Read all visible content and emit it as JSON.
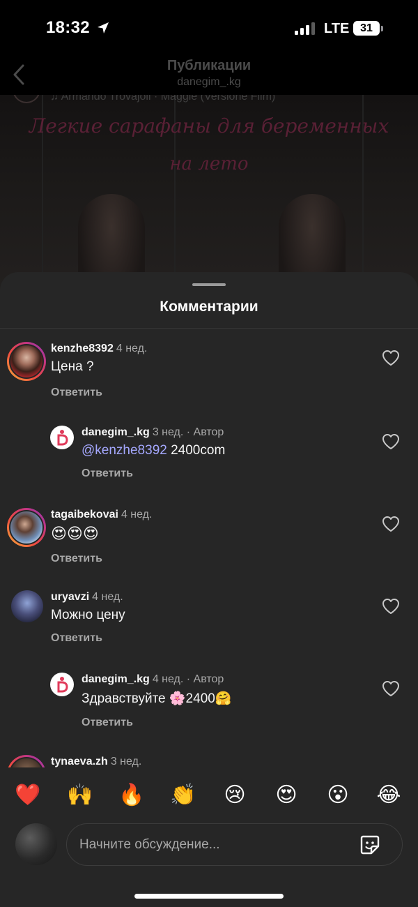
{
  "status_bar": {
    "time": "18:32",
    "network": "LTE",
    "battery": "31"
  },
  "header": {
    "title": "Публикации",
    "subtitle": "danegim_.kg"
  },
  "post": {
    "music": "Armando Trovajoli · Maggie (Versione Film)",
    "caption_line1": "Легкие сарафаны для беременных",
    "caption_line2": "на лето"
  },
  "sheet": {
    "title": "Комментарии"
  },
  "comments": [
    {
      "user": "kenzhe8392",
      "time": "4 нед.",
      "text": "Цена ?",
      "reply": "Ответить"
    },
    {
      "user": "danegim_.kg",
      "time": "3 нед. · Автор",
      "mention": "@kenzhe8392",
      "text": "2400com",
      "reply": "Ответить"
    },
    {
      "user": "tagaibekovai",
      "time": "4 нед.",
      "text": "😍😍😍",
      "reply": "Ответить"
    },
    {
      "user": "uryavzi",
      "time": "4 нед.",
      "text": "Можно цену",
      "reply": "Ответить"
    },
    {
      "user": "danegim_.kg",
      "time": "4 нед. · Автор",
      "text": "Здравствуйте 🌸2400🤗",
      "reply": "Ответить"
    },
    {
      "user": "tynaeva.zh",
      "time": "3 нед."
    }
  ],
  "emoji_bar": [
    "❤️",
    "🙌",
    "🔥",
    "👏",
    "😢",
    "😍",
    "😮",
    "😂"
  ],
  "input": {
    "placeholder": "Начните обсуждение..."
  },
  "colors": {
    "sheet_bg": "#262626",
    "mention": "#a5a8ff",
    "secondary_text": "#a8a8a8"
  }
}
